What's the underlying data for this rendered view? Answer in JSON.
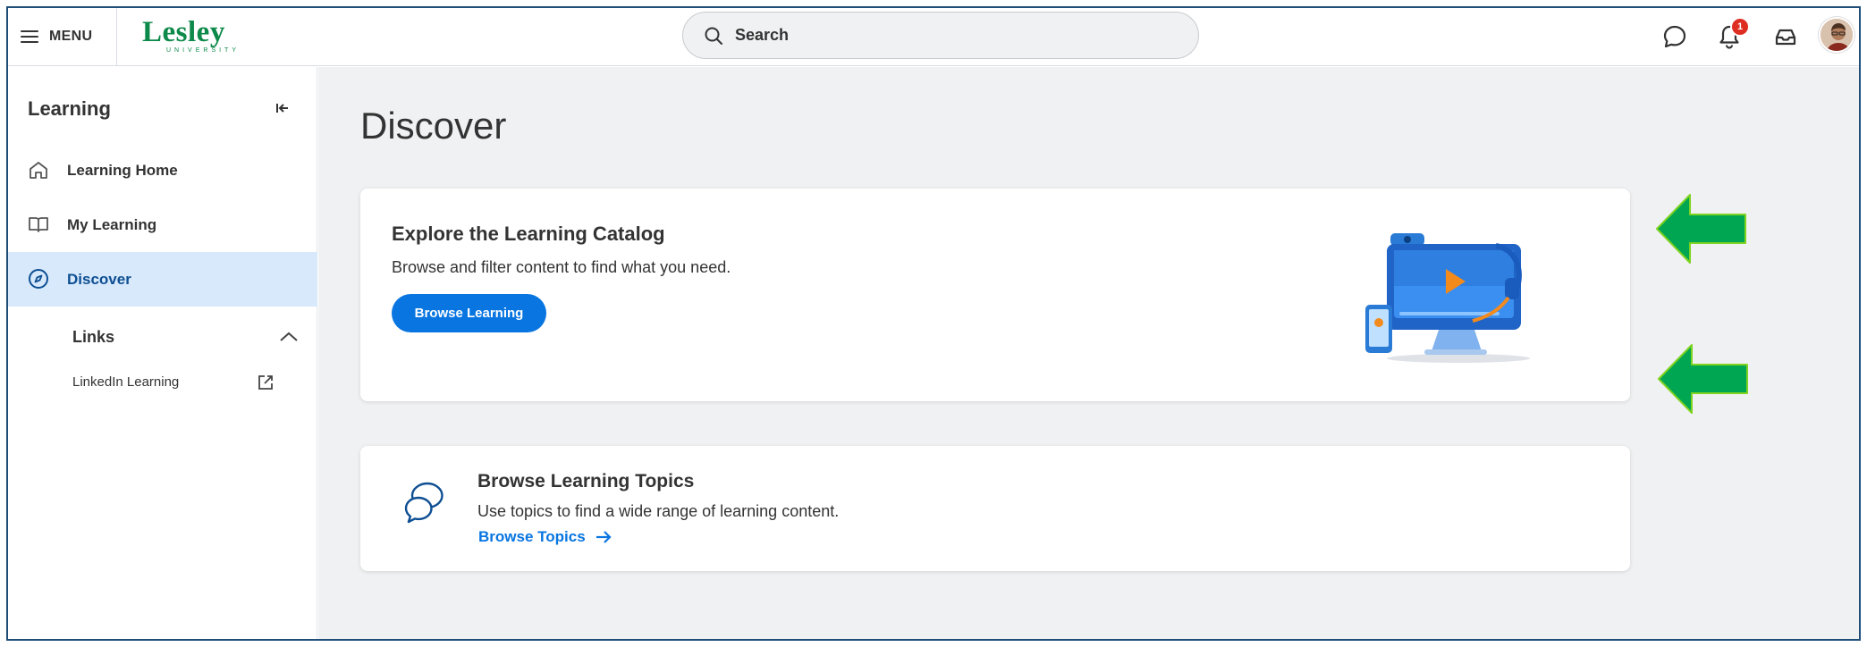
{
  "header": {
    "menu_label": "MENU",
    "logo_text": "Lesley",
    "logo_subtext": "UNIVERSITY",
    "search_placeholder": "Search",
    "notification_count": "1"
  },
  "sidebar": {
    "title": "Learning",
    "items": [
      {
        "label": "Learning Home",
        "icon": "home-icon"
      },
      {
        "label": "My Learning",
        "icon": "book-icon"
      },
      {
        "label": "Discover",
        "icon": "compass-icon",
        "active": true
      }
    ],
    "links_heading": "Links",
    "links": [
      {
        "label": "LinkedIn Learning",
        "icon": "external-link-icon"
      }
    ]
  },
  "main": {
    "page_title": "Discover",
    "catalog_card": {
      "title": "Explore the Learning Catalog",
      "description": "Browse and filter content to find what you need.",
      "button_label": "Browse Learning"
    },
    "topics_card": {
      "title": "Browse Learning Topics",
      "description": "Use topics to find a wide range of learning content.",
      "link_label": "Browse Topics"
    }
  },
  "colors": {
    "accent": "#0875e1",
    "brand_green": "#0d8a4a",
    "active_nav_bg": "#d7e9fa",
    "annotation_arrow": "#00a651",
    "badge": "#de2e21"
  }
}
